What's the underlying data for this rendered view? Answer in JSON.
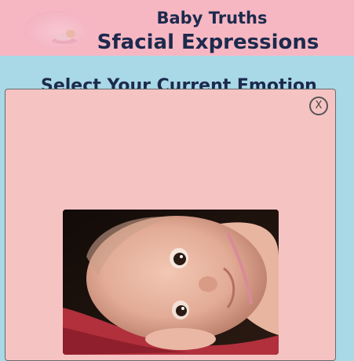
{
  "header": {
    "title": "Baby Truths",
    "subtitle": "Sfacial Expressions",
    "logo_icon": "sleeping-baby-logo"
  },
  "main": {
    "heading": "Select Your Current Emotion"
  },
  "modal": {
    "close_label": "X",
    "image_icon": "baby-photo"
  },
  "colors": {
    "header_bg": "#f6b7c3",
    "page_bg": "#a9d8e7",
    "modal_bg": "#f6c3c3",
    "text": "#1c2a4d"
  }
}
